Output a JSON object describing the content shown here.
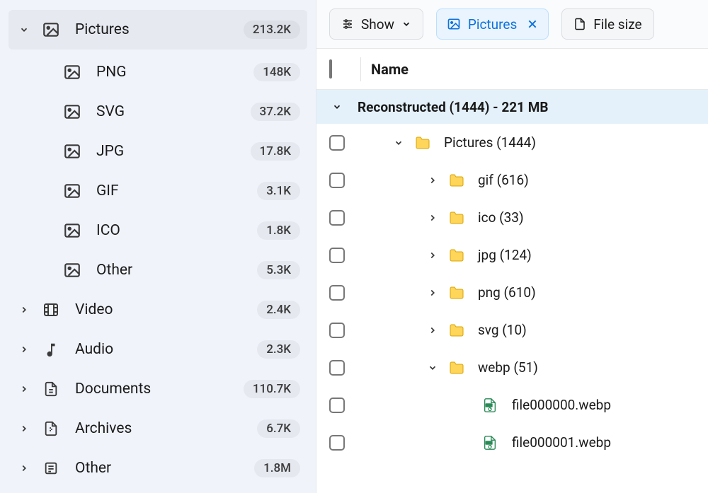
{
  "sidebar": {
    "pictures": {
      "label": "Pictures",
      "count": "213.2K"
    },
    "children": [
      {
        "label": "PNG",
        "count": "148K"
      },
      {
        "label": "SVG",
        "count": "37.2K"
      },
      {
        "label": "JPG",
        "count": "17.8K"
      },
      {
        "label": "GIF",
        "count": "3.1K"
      },
      {
        "label": "ICO",
        "count": "1.8K"
      },
      {
        "label": "Other",
        "count": "5.3K"
      }
    ],
    "top": [
      {
        "label": "Video",
        "count": "2.4K"
      },
      {
        "label": "Audio",
        "count": "2.3K"
      },
      {
        "label": "Documents",
        "count": "110.7K"
      },
      {
        "label": "Archives",
        "count": "6.7K"
      },
      {
        "label": "Other",
        "count": "1.8M"
      }
    ]
  },
  "toolbar": {
    "show": "Show",
    "chip": "Pictures",
    "filesize": "File size"
  },
  "header": {
    "name": "Name"
  },
  "group": {
    "label": "Reconstructed (1444) - 221 MB"
  },
  "rows": [
    {
      "indent": 0,
      "expanded": true,
      "kind": "folder",
      "label": "Pictures (1444)"
    },
    {
      "indent": 1,
      "expanded": false,
      "kind": "folder",
      "label": "gif (616)"
    },
    {
      "indent": 1,
      "expanded": false,
      "kind": "folder",
      "label": "ico (33)"
    },
    {
      "indent": 1,
      "expanded": false,
      "kind": "folder",
      "label": "jpg (124)"
    },
    {
      "indent": 1,
      "expanded": false,
      "kind": "folder",
      "label": "png (610)"
    },
    {
      "indent": 1,
      "expanded": false,
      "kind": "folder",
      "label": "svg (10)"
    },
    {
      "indent": 1,
      "expanded": true,
      "kind": "folder",
      "label": "webp (51)"
    },
    {
      "indent": 2,
      "expanded": null,
      "kind": "file",
      "label": "file000000.webp"
    },
    {
      "indent": 2,
      "expanded": null,
      "kind": "file",
      "label": "file000001.webp"
    }
  ]
}
